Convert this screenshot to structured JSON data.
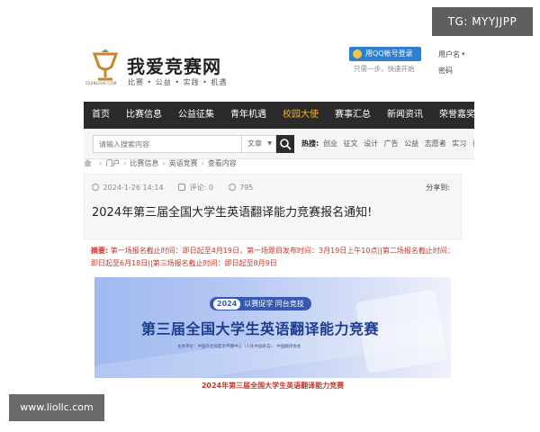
{
  "watermarks": {
    "top_right": "TG: MYYJJPP",
    "bottom_left": "www.liollc.com"
  },
  "header": {
    "site_name": "我爱竞赛网",
    "logo_small": "52JINGSAI.COM",
    "slogan": "比赛 • 公益 • 实践 • 机遇",
    "qq_login": "用QQ帐号登录",
    "qq_sub": "只需一步，快速开始",
    "username": "用户名",
    "password": "密码"
  },
  "nav": {
    "items": [
      {
        "label": "首页",
        "active": false
      },
      {
        "label": "比赛信息",
        "active": false
      },
      {
        "label": "公益征集",
        "active": false
      },
      {
        "label": "青年机遇",
        "active": false
      },
      {
        "label": "校园大使",
        "active": true
      },
      {
        "label": "赛事汇总",
        "active": false
      },
      {
        "label": "新闻资讯",
        "active": false
      },
      {
        "label": "荣誉嘉奖",
        "active": false
      }
    ]
  },
  "search": {
    "placeholder": "请输入搜索内容",
    "type": "文章",
    "hot_label": "热搜:",
    "hot_words": [
      "创业",
      "征文",
      "设计",
      "广告",
      "公益",
      "志愿者",
      "实习",
      "训练"
    ]
  },
  "breadcrumb": [
    "门户",
    "比赛信息",
    "英语竞赛",
    "查看内容"
  ],
  "article": {
    "date": "2024-1-26 14:14",
    "comments_label": "评论: 0",
    "views": "795",
    "share": "分享到:",
    "title": "2024年第三届全国大学生英语翻译能力竞赛报名通知!"
  },
  "summary": {
    "label": "摘要:",
    "text": " 第一场报名截止时间：即日起至4月19日，第一场题目发布时间：3月19日上午10点||第二场报名截止时间：即日起至6月18日||第三场报名截止时间：即日起至8月9日"
  },
  "banner": {
    "year": "2024",
    "tag": "以赛促学 同台竞技",
    "title": "第三届全国大学生英语翻译能力竞赛",
    "org": "主办单位：中国外文局亚太传播中心（人民中国杂志）、中国翻译协会"
  },
  "caption": "2024年第三届全国大学生英语翻译能力竞赛"
}
